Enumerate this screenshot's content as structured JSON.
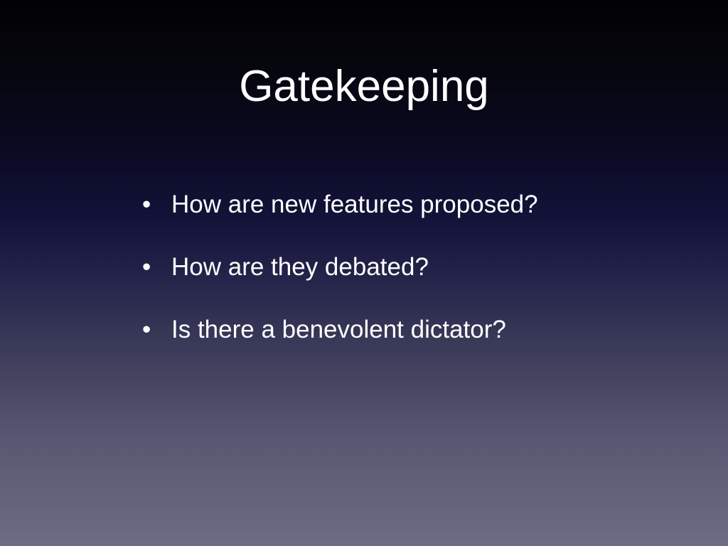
{
  "slide": {
    "title": "Gatekeeping",
    "bullet_symbol": "•",
    "bullets": [
      {
        "text": "How are new features proposed?"
      },
      {
        "text": "How are they debated?"
      },
      {
        "text": "Is there a benevolent dictator?"
      }
    ]
  },
  "colors": {
    "text": "#ffffff",
    "background_top": "#020204",
    "background_bottom": "#6e6c84"
  }
}
